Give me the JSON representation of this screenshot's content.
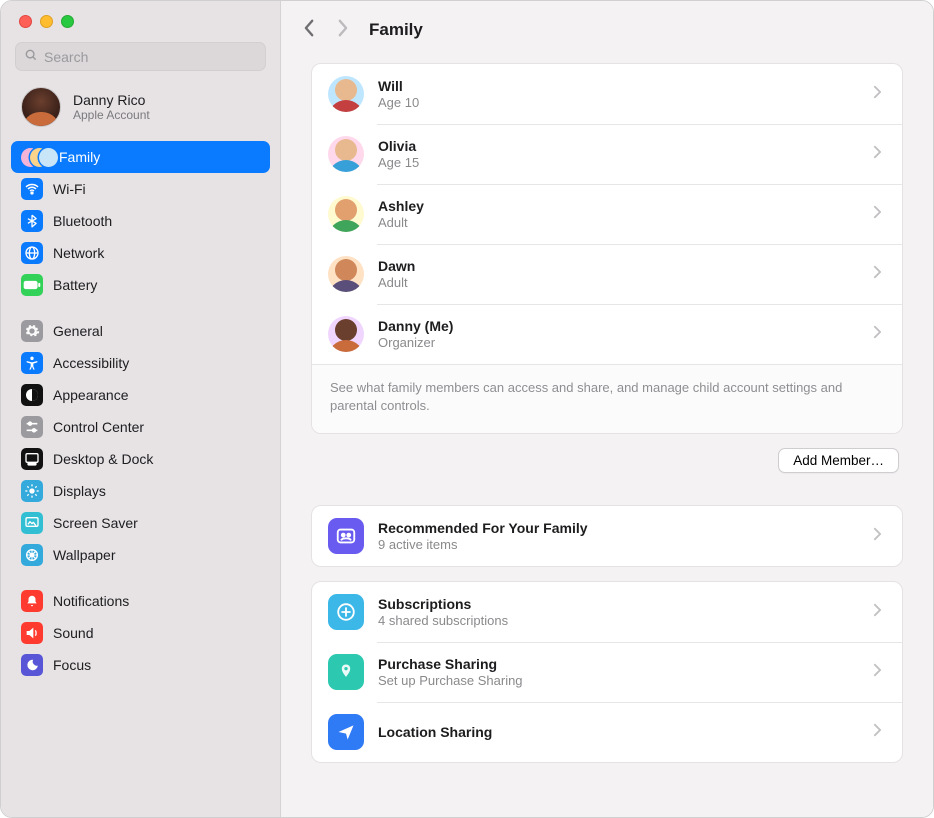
{
  "search": {
    "placeholder": "Search"
  },
  "account": {
    "name": "Danny Rico",
    "sub": "Apple Account"
  },
  "sidebar": {
    "family_label": "Family",
    "groups": [
      [
        {
          "label": "Wi-Fi",
          "icon": "wifi",
          "bg": "#0a7aff"
        },
        {
          "label": "Bluetooth",
          "icon": "bluetooth",
          "bg": "#0a7aff"
        },
        {
          "label": "Network",
          "icon": "network",
          "bg": "#0a7aff"
        },
        {
          "label": "Battery",
          "icon": "battery",
          "bg": "#32d158"
        }
      ],
      [
        {
          "label": "General",
          "icon": "gear",
          "bg": "#9b9b9f"
        },
        {
          "label": "Accessibility",
          "icon": "accessibility",
          "bg": "#0a7aff"
        },
        {
          "label": "Appearance",
          "icon": "appearance",
          "bg": "#111111"
        },
        {
          "label": "Control Center",
          "icon": "sliders",
          "bg": "#9b9b9f"
        },
        {
          "label": "Desktop & Dock",
          "icon": "dock",
          "bg": "#111111"
        },
        {
          "label": "Displays",
          "icon": "displays",
          "bg": "#34aadc"
        },
        {
          "label": "Screen Saver",
          "icon": "screensaver",
          "bg": "#32bfd4"
        },
        {
          "label": "Wallpaper",
          "icon": "wallpaper",
          "bg": "#34aadc"
        }
      ],
      [
        {
          "label": "Notifications",
          "icon": "bell",
          "bg": "#ff3b30"
        },
        {
          "label": "Sound",
          "icon": "sound",
          "bg": "#ff3b30"
        },
        {
          "label": "Focus",
          "icon": "focus",
          "bg": "#5856d6"
        }
      ]
    ]
  },
  "header": {
    "title": "Family"
  },
  "members": [
    {
      "name": "Will",
      "sub": "Age 10",
      "bg": "#bfe6ff",
      "skin": "#e8b98e",
      "shirt": "#c43f3f"
    },
    {
      "name": "Olivia",
      "sub": "Age 15",
      "bg": "#ffd8ec",
      "skin": "#e8b98e",
      "shirt": "#37a0d8"
    },
    {
      "name": "Ashley",
      "sub": "Adult",
      "bg": "#fffad0",
      "skin": "#e2a06e",
      "shirt": "#3fa55a"
    },
    {
      "name": "Dawn",
      "sub": "Adult",
      "bg": "#ffe1c4",
      "skin": "#d0875a",
      "shirt": "#5a4f7a"
    },
    {
      "name": "Danny (Me)",
      "sub": "Organizer",
      "bg": "#f0d6ff",
      "skin": "#6b3f2e",
      "shirt": "#c96b3a"
    }
  ],
  "members_footer": "See what family members can access and share, and manage child account settings and parental controls.",
  "add_member_label": "Add Member…",
  "tiles": {
    "recommended": {
      "title": "Recommended For Your Family",
      "sub": "9 active items",
      "bg": "#6a5bf0"
    },
    "subscriptions": {
      "title": "Subscriptions",
      "sub": "4 shared subscriptions",
      "bg": "#3bb8e8"
    },
    "purchase": {
      "title": "Purchase Sharing",
      "sub": "Set up Purchase Sharing",
      "bg": "#2cc9b0"
    },
    "location": {
      "title": "Location Sharing",
      "sub": "",
      "bg": "#2f7af5"
    }
  }
}
